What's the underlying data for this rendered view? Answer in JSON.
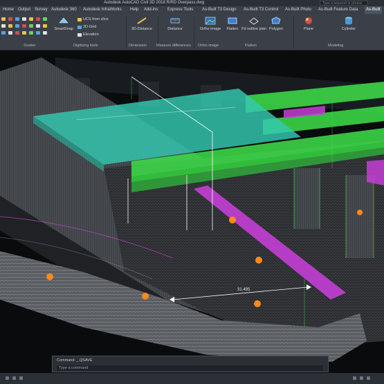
{
  "title_bar": {
    "title": "Autodesk AutoCAD Civil 3D 2018    R/RD Overpass.dwg",
    "search_placeholder": "Type a keyword or phrase"
  },
  "menu": {
    "items": [
      "Home",
      "Output",
      "Survey",
      "Autodesk 360",
      "Autodesk InfraWorks",
      "Help",
      "Add-ins",
      "Express Tools",
      "As-Built T3 Design",
      "As-Built T3 Control",
      "As-Built Photo",
      "As-Built Feature Data",
      "As-Built"
    ],
    "active_index": 12
  },
  "ribbon": {
    "tools": {
      "smartsnap": "SmartSnap",
      "ucs_from_slice": "UCS from slice",
      "grid_2d": "2D-Grid",
      "elevation": "Elevation",
      "distance_3d": "3D-Distance",
      "distance": "Distance",
      "ortho_image": "Ortho image",
      "flatten": "Flatten",
      "fit_outline_plan": "Fit outline plan",
      "polygon": "Polygon",
      "plane": "Plane",
      "cylinder": "Cylinder"
    },
    "panels": {
      "scatter": "Scatter",
      "digitizing_tools": "Digitizing tools",
      "dimension": "Dimension",
      "measure_differences": "Measure differences",
      "ortho_image": "Ortho image",
      "flatten": "Flatten",
      "modeling": "Modeling"
    }
  },
  "viewport": {
    "dimension_label": "31.495"
  },
  "command_line": {
    "history": "Command: _.QSAVE",
    "input_placeholder": "Type a command"
  },
  "colors": {
    "deck": "#35c9b1",
    "green_beams": "#3ee04a",
    "magenta": "#c43fd6",
    "points": "#ff8a1e"
  }
}
